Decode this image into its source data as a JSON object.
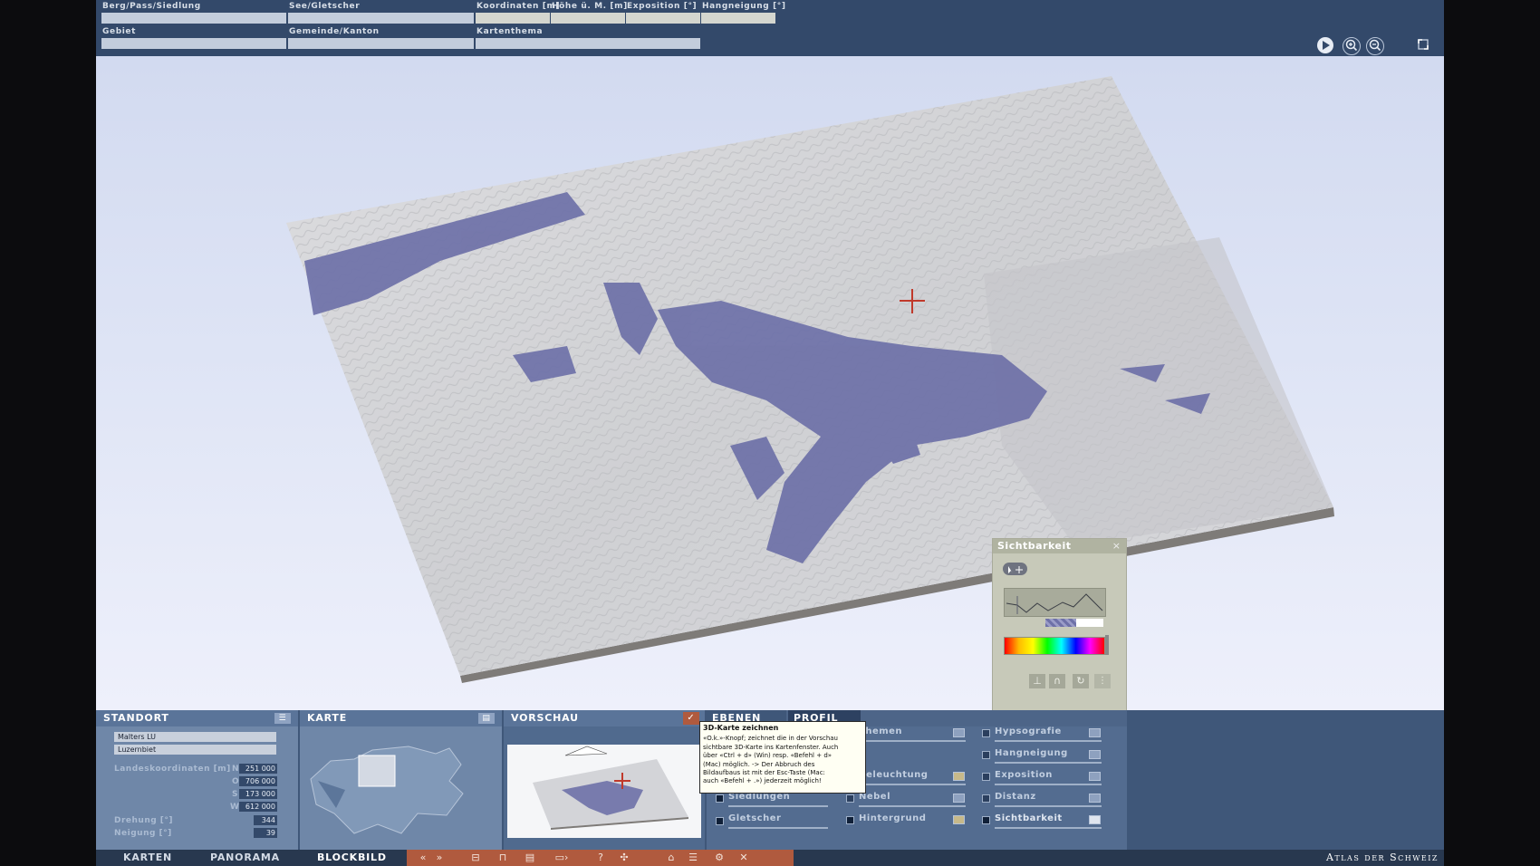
{
  "top_fields": {
    "berg": {
      "label": "Berg/Pass/Siedlung",
      "value": ""
    },
    "see": {
      "label": "See/Gletscher",
      "value": ""
    },
    "koordinaten": {
      "label": "Koordinaten [m]",
      "value": ""
    },
    "hoehe": {
      "label": "Höhe ü. M. [m]",
      "value": ""
    },
    "exposition": {
      "label": "Exposition [°]",
      "value": ""
    },
    "hangneigung": {
      "label": "Hangneigung [°]",
      "value": ""
    },
    "gebiet": {
      "label": "Gebiet",
      "value": ""
    },
    "gemeinde": {
      "label": "Gemeinde/Kanton",
      "value": ""
    },
    "kartenthema": {
      "label": "Kartenthema",
      "value": ""
    }
  },
  "top_icons": [
    "play-icon",
    "zoom-in-icon",
    "zoom-out-icon",
    "fullscreen-icon"
  ],
  "sichtbarkeit": {
    "title": "Sichtbarkeit",
    "close": "×"
  },
  "standort": {
    "title": "STANDORT",
    "ort": "Malters  LU",
    "gebiet": "Luzernbiet",
    "coord_label": "Landeskoordinaten [m]",
    "coords": [
      {
        "dir": "N",
        "value": "251 000"
      },
      {
        "dir": "O",
        "value": "706 000"
      },
      {
        "dir": "S",
        "value": "173 000"
      },
      {
        "dir": "W",
        "value": "612 000"
      }
    ],
    "drehung_label": "Drehung [°]",
    "drehung": "344",
    "neigung_label": "Neigung [°]",
    "neigung": "39"
  },
  "karte": {
    "title": "KARTE"
  },
  "vorschau": {
    "title": "VORSCHAU"
  },
  "tabs": {
    "ebenen": "EBENEN",
    "profil": "PROFIL"
  },
  "layers": {
    "siedlungen": "Siedlungen",
    "gletscher": "Gletscher",
    "themen": "Themen",
    "beleuchtung": "Beleuchtung",
    "nebel": "Nebel",
    "hintergrund": "Hintergrund",
    "hypsografie": "Hypsografie",
    "hangneigung": "Hangneigung",
    "exposition": "Exposition",
    "distanz": "Distanz",
    "sichtbarkeit": "Sichtbarkeit"
  },
  "tooltip": {
    "title": "3D-Karte zeichnen",
    "lines": [
      "«O.k.»-Knopf; zeichnet die in der Vorschau",
      "sichtbare 3D-Karte ins Kartenfenster. Auch",
      "über «Ctrl + d» (Win) resp. «Befehl + d»",
      "(Mac) möglich. -> Der Abbruch des",
      "Bildaufbaus ist mit der Esc-Taste (Mac:",
      "auch «Befehl + .») jederzeit möglich!"
    ]
  },
  "nav": {
    "karten": "KARTEN",
    "panorama": "PANORAMA",
    "blockbild": "BLOCKBILD"
  },
  "toolbar_icons": [
    "back-icon",
    "forward-icon",
    "layers-icon",
    "lock-icon",
    "print-icon",
    "export-icon",
    "help-icon",
    "rotate-icon",
    "home-icon",
    "list-icon",
    "settings-icon",
    "close-icon"
  ],
  "brand": "Atlas der Schweiz",
  "colors": {
    "accent": "#b05a3e",
    "visibility": "#6e71a8",
    "terrain": "#cfd0d2"
  }
}
